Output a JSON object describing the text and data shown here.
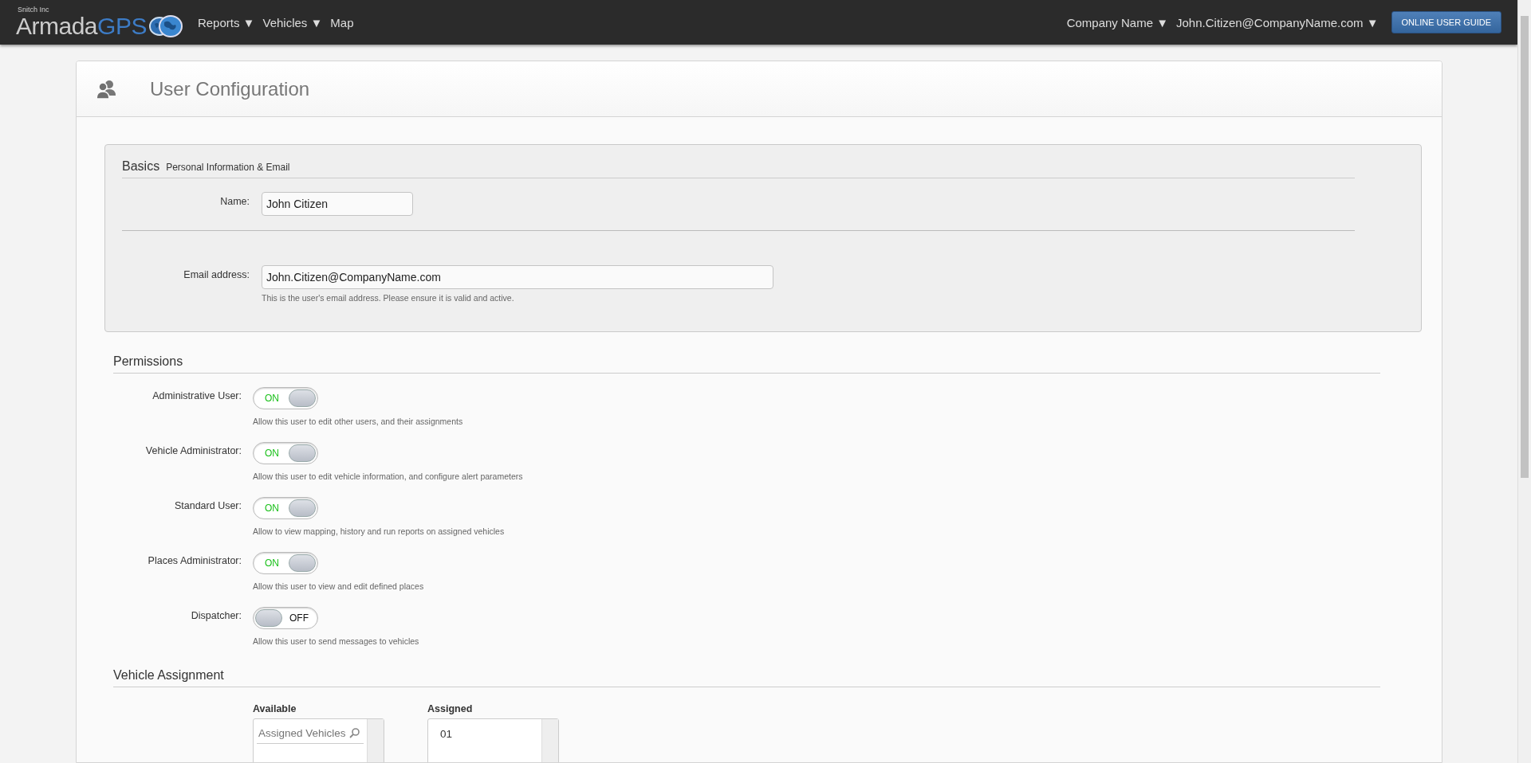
{
  "navbar": {
    "company": "Snitch Inc",
    "logo_left": "Armada",
    "logo_right": "GPS",
    "menus": [
      {
        "label": "Reports",
        "caret": "▼"
      },
      {
        "label": "Vehicles",
        "caret": "▼"
      },
      {
        "label": "Map"
      }
    ],
    "account_menus": [
      {
        "label": "Company Name",
        "caret": "▼"
      },
      {
        "label": "John.Citizen@CompanyName.com",
        "caret": "▼"
      }
    ],
    "guide_button": "ONLINE USER GUIDE"
  },
  "page": {
    "title": "User Configuration"
  },
  "basics": {
    "heading": "Basics",
    "subheading": "Personal Information & Email",
    "fields": [
      {
        "label": "Name:",
        "value": "John Citizen"
      },
      {
        "label": "Email address:",
        "value": "John.Citizen@CompanyName.com",
        "hint": "This is the user's email address. Please ensure it is valid and active."
      }
    ]
  },
  "permissions": {
    "heading": "Permissions",
    "items": [
      {
        "label": "Administrative User:",
        "on": true,
        "state_text": "ON",
        "hint": "Allow this user to edit other users, and their assignments"
      },
      {
        "label": "Vehicle Administrator:",
        "on": true,
        "state_text": "ON",
        "hint": "Allow this user to edit vehicle information, and configure alert parameters"
      },
      {
        "label": "Standard User:",
        "on": true,
        "state_text": "ON",
        "hint": "Allow to view mapping, history and run reports on assigned vehicles"
      },
      {
        "label": "Places Administrator:",
        "on": true,
        "state_text": "ON",
        "hint": "Allow this user to view and edit defined places"
      },
      {
        "label": "Dispatcher:",
        "on": false,
        "state_text": "OFF",
        "hint": "Allow this user to send messages to vehicles"
      }
    ]
  },
  "vehicle_assignment": {
    "heading": "Vehicle Assignment",
    "available": {
      "label": "Available",
      "placeholder": "Assigned Vehicles"
    },
    "assigned": {
      "label": "Assigned",
      "items": [
        "01"
      ]
    }
  }
}
